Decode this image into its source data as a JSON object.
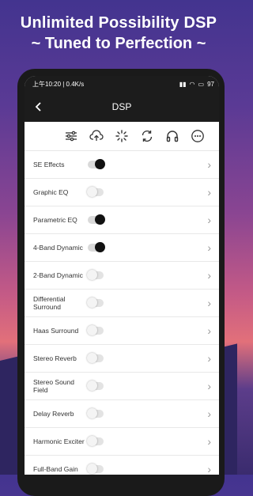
{
  "promo": {
    "line1": "Unlimited Possibility DSP",
    "line2": "~ Tuned to Perfection ~"
  },
  "statusbar": {
    "time_text": "上午10:20 | 0.4K/s",
    "battery": "97"
  },
  "header": {
    "title": "DSP",
    "back_icon": "back-arrow-icon"
  },
  "toolbar": {
    "icons": [
      "equalizer-sliders-icon",
      "upload-cloud-icon",
      "loading-spinner-icon",
      "sync-icon",
      "headphones-icon",
      "more-options-icon"
    ]
  },
  "effects": [
    {
      "label": "SE Effects",
      "on": true
    },
    {
      "label": "Graphic EQ",
      "on": false
    },
    {
      "label": "Parametric EQ",
      "on": true
    },
    {
      "label": "4-Band Dynamic",
      "on": true
    },
    {
      "label": "2-Band Dynamic",
      "on": false
    },
    {
      "label": "Differential Surround",
      "on": false
    },
    {
      "label": "Haas Surround",
      "on": false
    },
    {
      "label": "Stereo Reverb",
      "on": false
    },
    {
      "label": "Stereo Sound Field",
      "on": false
    },
    {
      "label": "Delay Reverb",
      "on": false
    },
    {
      "label": "Harmonic Exciter",
      "on": false
    },
    {
      "label": "Full-Band Gain",
      "on": false
    }
  ],
  "colors": {
    "accent_dark": "#111111",
    "bar_bg": "#1c1c1c"
  }
}
